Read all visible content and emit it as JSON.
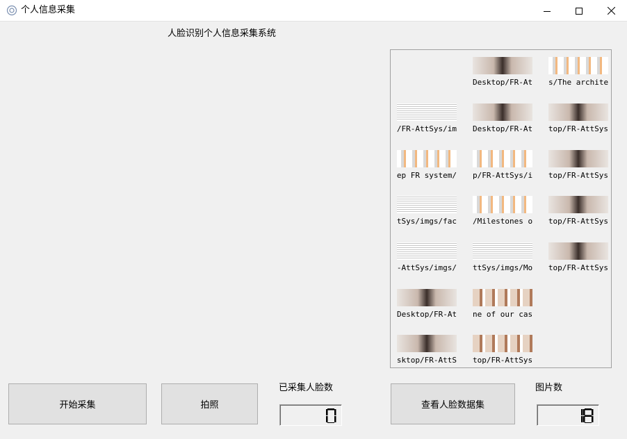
{
  "window": {
    "title": "个人信息采集",
    "icon": "app-gear-icon",
    "controls": [
      "minimize-icon",
      "maximize-icon",
      "close-icon"
    ]
  },
  "heading": "人脸识别个人信息采集系统",
  "gallery": {
    "items": [
      {
        "caption": "",
        "kind": "blank"
      },
      {
        "caption": "Desktop/FR-AttS",
        "kind": "face",
        "rtl": false
      },
      {
        "caption": "s/The architec",
        "kind": "diagram",
        "rtl": false
      },
      {
        "caption": "p/FR-AttSys/im",
        "kind": "table",
        "rtl": true
      },
      {
        "caption": "Desktop/FR-AttS",
        "kind": "face",
        "rtl": false
      },
      {
        "caption": "sktop/FR-AttSys",
        "kind": "face",
        "rtl": true
      },
      {
        "caption": "/Deep FR system",
        "kind": "diagram",
        "rtl": true
      },
      {
        "caption": "p/FR-AttSys/im",
        "kind": "diagram",
        "rtl": false
      },
      {
        "caption": "sktop/FR-AttSys",
        "kind": "face",
        "rtl": true
      },
      {
        "caption": "AttSys/imgs/fac",
        "kind": "table",
        "rtl": true
      },
      {
        "caption": "/Milestones of",
        "kind": "diagram",
        "rtl": false
      },
      {
        "caption": "sktop/FR-AttSys",
        "kind": "face",
        "rtl": true
      },
      {
        "caption": "/FR-AttSys/imgs/",
        "kind": "table",
        "rtl": true
      },
      {
        "caption": "ttSys/imgs/Mobi",
        "kind": "table",
        "rtl": false
      },
      {
        "caption": "sktop/FR-AttSys",
        "kind": "face",
        "rtl": true
      },
      {
        "caption": "Desktop/FR-AttS",
        "kind": "face",
        "rtl": false
      },
      {
        "caption": "ne of our casc",
        "kind": "grid",
        "rtl": false
      },
      {
        "caption": "",
        "kind": "none"
      },
      {
        "caption": "Desktop/FR-AttS",
        "kind": "face",
        "rtl": true
      },
      {
        "caption": "top/FR-AttSys/",
        "kind": "grid",
        "rtl": false
      }
    ]
  },
  "buttons": {
    "start": "开始采集",
    "photo": "拍照",
    "view": "查看人脸数据集"
  },
  "counters": {
    "collected_label": "已采集人脸数",
    "collected_value": "0",
    "images_label": "图片数",
    "images_value": "18"
  }
}
